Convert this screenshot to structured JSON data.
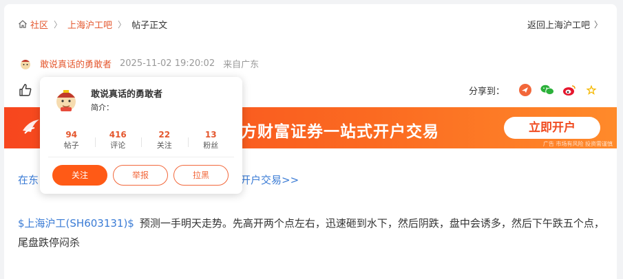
{
  "breadcrumb": {
    "home": "社区",
    "forum": "上海沪工吧",
    "current": "帖子正文",
    "back": "返回上海沪工吧"
  },
  "post": {
    "author": "敢说真话的勇敢者",
    "time": "2025-11-02 19:20:02",
    "from": "来自广东",
    "stock": "$上海沪工(SH603131)$",
    "content": "预测一手明天走势。先高开两个点左右，迅速砸到水下，然后阴跌，盘中会诱多，然后下午跌五个点，尾盘跌停闷杀"
  },
  "share": {
    "label": "分享到："
  },
  "banner": {
    "title": "东方财富证券一站式开户交易",
    "button": "立即开户",
    "ad_note": "广告 市场有风险 投资需谨慎"
  },
  "promo": {
    "left": "在东",
    "right": "式开户交易>>"
  },
  "profile_popover": {
    "name": "敢说真话的勇敢者",
    "intro": "简介：",
    "stats": [
      {
        "num": "94",
        "label": "帖子"
      },
      {
        "num": "416",
        "label": "评论"
      },
      {
        "num": "22",
        "label": "关注"
      },
      {
        "num": "13",
        "label": "粉丝"
      }
    ],
    "buttons": {
      "follow": "关注",
      "report": "举报",
      "block": "拉黑"
    }
  },
  "colors": {
    "accent": "#e4572e",
    "link": "#3a7bd5",
    "banner": "#f7461e"
  },
  "icons": [
    "home-icon",
    "thumbs-up-icon",
    "share-app-icon",
    "wechat-icon",
    "weibo-icon",
    "star-icon",
    "avatar"
  ]
}
